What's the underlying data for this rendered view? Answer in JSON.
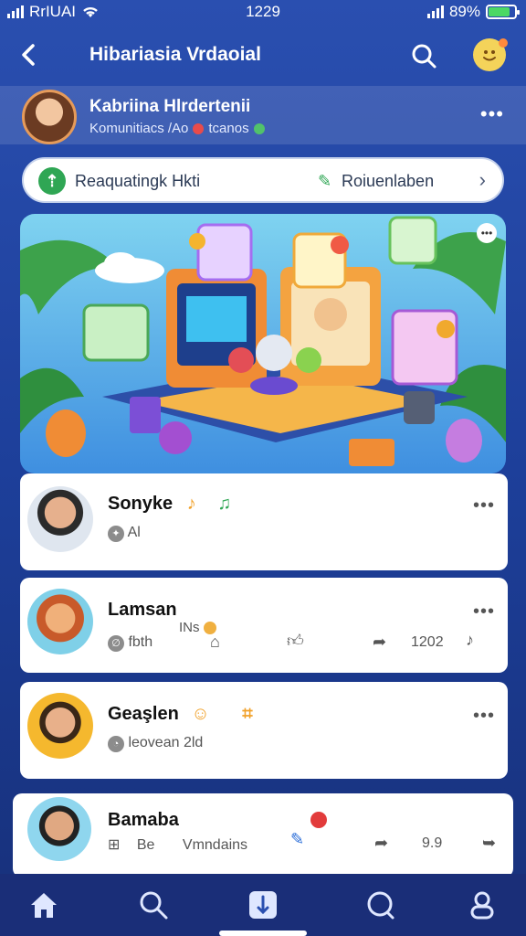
{
  "status_bar": {
    "carrier": "RrIUAI",
    "time": "1229",
    "battery_percent": "89%",
    "battery_level": 0.89
  },
  "header": {
    "title": "Hibariasia Vrdaoial",
    "back_icon": "back-chevron-icon",
    "search_icon": "search-icon",
    "avatar_icon": "smiley-avatar-icon"
  },
  "profile": {
    "name": "Kabriina Hlrdertenii",
    "subtitle_before": "Komunitiacs /Ao",
    "subtitle_after": "tcanos",
    "more_icon": "more-icon"
  },
  "action_bar": {
    "left_label": "Reaquatingk Hkti",
    "right_label": "Roiuenlaben"
  },
  "hero": {
    "description_icon": "hero-illustration"
  },
  "posts": [
    {
      "name": "Sonyke",
      "meta": "Al",
      "badge_emoji": "♪"
    },
    {
      "name": "Lamsan",
      "meta": "fbth",
      "tag": "INs",
      "count": "1202"
    },
    {
      "name": "Geaşlen",
      "meta": "leovean 2ld"
    },
    {
      "name": "Bamaba",
      "meta_left": "Be",
      "meta_mid": "Vmndains",
      "count": "9.9"
    }
  ],
  "colors": {
    "header_bg": "#2a4fb0",
    "nav_bg": "#1a2e78",
    "accent_green": "#2fa654"
  }
}
